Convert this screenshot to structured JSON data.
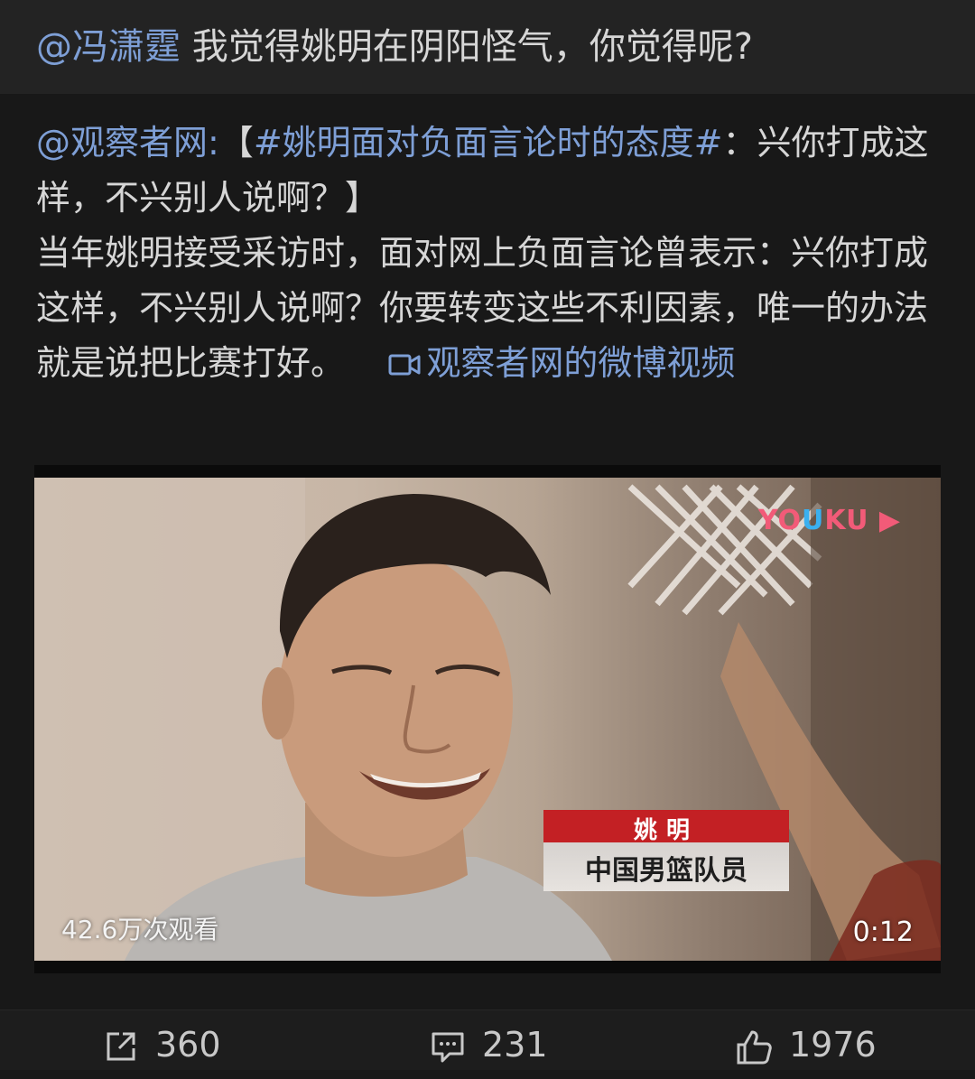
{
  "header": {
    "mention": "@冯潇霆",
    "text": " 我觉得姚明在阴阳怪气，你觉得呢?"
  },
  "post": {
    "author": "@观察者网",
    "colon": ":",
    "bracket_open": "【",
    "hashtag": "#姚明面对负面言论时的态度#",
    "title_rest": "：兴你打成这样，不兴别人说啊？】",
    "body": "当年姚明接受采访时，面对网上负面言论曾表示：兴你打成这样，不兴别人说啊？你要转变这些不利因素，唯一的办法就是说把比赛打好。",
    "video_link": "观察者网的微博视频"
  },
  "video": {
    "logo_you": "YO",
    "logo_u": "U",
    "logo_ku": "KU",
    "caption_name": "姚明",
    "caption_title": "中国男篮队员",
    "views": "42.6万次观看",
    "duration": "0:12"
  },
  "actions": {
    "share_count": "360",
    "comment_count": "231",
    "like_count": "1976"
  }
}
